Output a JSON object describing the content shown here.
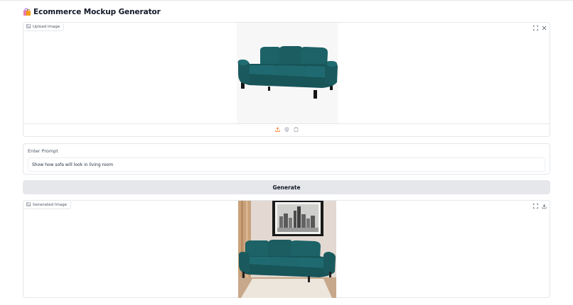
{
  "app": {
    "icon": "shopping-bags-icon",
    "title": "Ecommerce Mockup Generator"
  },
  "upload": {
    "label": "Upload Image",
    "label_icon": "image-icon",
    "tools": [
      "fullscreen-icon",
      "close-icon"
    ],
    "bottom_tools": [
      "upload-icon",
      "webcam-icon",
      "clipboard-icon"
    ],
    "image": "teal-sofa-product-photo",
    "accent_color": "#f97316"
  },
  "prompt": {
    "label": "Enter Prompt",
    "value": "Show how sofa will look in living room"
  },
  "generate": {
    "label": "Generate"
  },
  "generated": {
    "label": "Generated Image",
    "label_icon": "image-icon",
    "tools": [
      "fullscreen-icon",
      "download-icon"
    ],
    "image": "teal-sofa-in-living-room"
  },
  "colors": {
    "sofa_teal": "#1b5d61",
    "border": "#e5e7eb",
    "button_bg": "#e5e7eb"
  }
}
